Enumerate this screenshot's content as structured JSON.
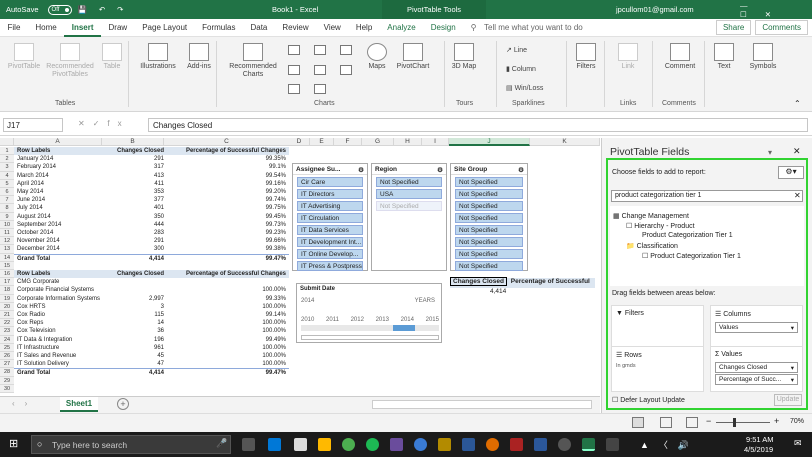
{
  "title_bar": {
    "autosave": "AutoSave",
    "autosave_state": "Off",
    "filename": "Book1 - Excel",
    "context_tab": "PivotTable Tools",
    "user": "jpcullom01@gmail.com"
  },
  "menu": {
    "items": [
      "File",
      "Home",
      "Insert",
      "Draw",
      "Page Layout",
      "Formulas",
      "Data",
      "Review",
      "View",
      "Help",
      "Analyze",
      "Design"
    ],
    "tell_me": "Tell me what you want to do",
    "share": "Share",
    "comments": "Comments"
  },
  "ribbon": {
    "buttons": {
      "pivottable": "PivotTable",
      "rec_pivot": "Recommended PivotTables",
      "table": "Table",
      "illustrations": "Illustrations",
      "addins": "Add-ins",
      "rec_charts": "Recommended Charts",
      "maps": "Maps",
      "pivotchart": "PivotChart",
      "map3d": "3D Map",
      "line": "Line",
      "column": "Column",
      "winloss": "Win/Loss",
      "filters": "Filters",
      "link": "Link",
      "comment": "Comment",
      "text": "Text",
      "symbols": "Symbols"
    },
    "groups": {
      "tables": "Tables",
      "charts": "Charts",
      "tours": "Tours",
      "sparklines": "Sparklines",
      "links": "Links",
      "comments": "Comments"
    }
  },
  "formula_bar": {
    "name_box": "J17",
    "formula": "Changes Closed"
  },
  "columns": [
    "A",
    "B",
    "C",
    "D",
    "E",
    "F",
    "G",
    "H",
    "I",
    "J",
    "K"
  ],
  "pivot1": {
    "headers": [
      "Row Labels",
      "Changes Closed",
      "Percentage of Successful Changes"
    ],
    "rows": [
      [
        "January 2014",
        "291",
        "99.35%"
      ],
      [
        "February 2014",
        "317",
        "99.1%"
      ],
      [
        "March 2014",
        "413",
        "99.54%"
      ],
      [
        "April 2014",
        "411",
        "99.16%"
      ],
      [
        "May 2014",
        "353",
        "99.20%"
      ],
      [
        "June 2014",
        "377",
        "99.74%"
      ],
      [
        "July 2014",
        "401",
        "99.75%"
      ],
      [
        "August 2014",
        "350",
        "99.45%"
      ],
      [
        "September 2014",
        "444",
        "99.73%"
      ],
      [
        "October 2014",
        "283",
        "99.23%"
      ],
      [
        "November 2014",
        "291",
        "99.66%"
      ],
      [
        "December 2014",
        "300",
        "99.38%"
      ]
    ],
    "total": [
      "Grand Total",
      "4,414",
      "99.47%"
    ]
  },
  "pivot2": {
    "headers": [
      "Row Labels",
      "Changes Closed",
      "Percentage of Successful Changes"
    ],
    "rows": [
      [
        "CMG Corporate",
        "",
        ""
      ],
      [
        "Corporate Financial Systems",
        "",
        "100.00%"
      ],
      [
        "Corporate Information Systems",
        "2,997",
        "99.33%"
      ],
      [
        "Cox HRTS",
        "3",
        "100.00%"
      ],
      [
        "Cox Radio",
        "115",
        "99.14%"
      ],
      [
        "Cox Reps",
        "14",
        "100.00%"
      ],
      [
        "Cox Television",
        "36",
        "100.00%"
      ],
      [
        "IT Data & Integration",
        "196",
        "99.49%"
      ],
      [
        "IT Infrastructure",
        "961",
        "100.00%"
      ],
      [
        "IT Sales and Revenue",
        "45",
        "100.00%"
      ],
      [
        "IT Solution Delivery",
        "47",
        "100.00%"
      ]
    ],
    "total": [
      "Grand Total",
      "4,414",
      "99.47%"
    ]
  },
  "row_numbers": [
    "1",
    "2",
    "3",
    "4",
    "5",
    "6",
    "7",
    "8",
    "9",
    "10",
    "11",
    "12",
    "13",
    "14",
    "15",
    "16",
    "17",
    "18",
    "19",
    "20",
    "21",
    "22",
    "23",
    "24",
    "25",
    "26",
    "27",
    "28",
    "29",
    "30"
  ],
  "slicers": {
    "assignee": {
      "title": "Assignee Su...",
      "items": [
        "Cir Care",
        "IT Directors",
        "IT Advertising",
        "IT Circulation",
        "IT Data Services",
        "IT Development Int...",
        "IT Online Develop...",
        "IT Press & Postpress"
      ]
    },
    "region": {
      "title": "Region",
      "items": [
        "Not Specified",
        "USA",
        "Not Specified"
      ]
    },
    "site": {
      "title": "Site Group",
      "items": [
        "Not Specified",
        "Not Specified",
        "Not Specified",
        "Not Specified",
        "Not Specified",
        "Not Specified",
        "Not Specified",
        "Not Specified"
      ]
    }
  },
  "mini_pivot": {
    "h1": "Changes Closed",
    "h2": "Percentage of Successful",
    "value": "4,414"
  },
  "timeline": {
    "title": "Submit Date",
    "year": "2014",
    "level": "YEARS",
    "labels": [
      "2010",
      "2011",
      "2012",
      "2013",
      "2014",
      "2015"
    ]
  },
  "sheet": {
    "tab": "Sheet1"
  },
  "status": {
    "zoom": "70%"
  },
  "fields_pane": {
    "title": "PivotTable Fields",
    "choose": "Choose fields to add to report:",
    "search": "product categorization tier 1",
    "tree": [
      "Change Management",
      "Hierarchy - Product",
      "Product Categorization Tier 1",
      "Classification",
      "Product Categorization Tier 1"
    ],
    "drag": "Drag fields between areas below:",
    "filters": "Filters",
    "columns": "Columns",
    "columns_value": "Values",
    "rows": "Rows",
    "rows_value": "In gmds",
    "values": "Values",
    "values_items": [
      "Changes Closed",
      "Percentage of Succ..."
    ],
    "defer": "Defer Layout Update",
    "update": "Update"
  },
  "taskbar": {
    "search": "Type here to search",
    "time": "9:51 AM",
    "date": "4/5/2019"
  }
}
